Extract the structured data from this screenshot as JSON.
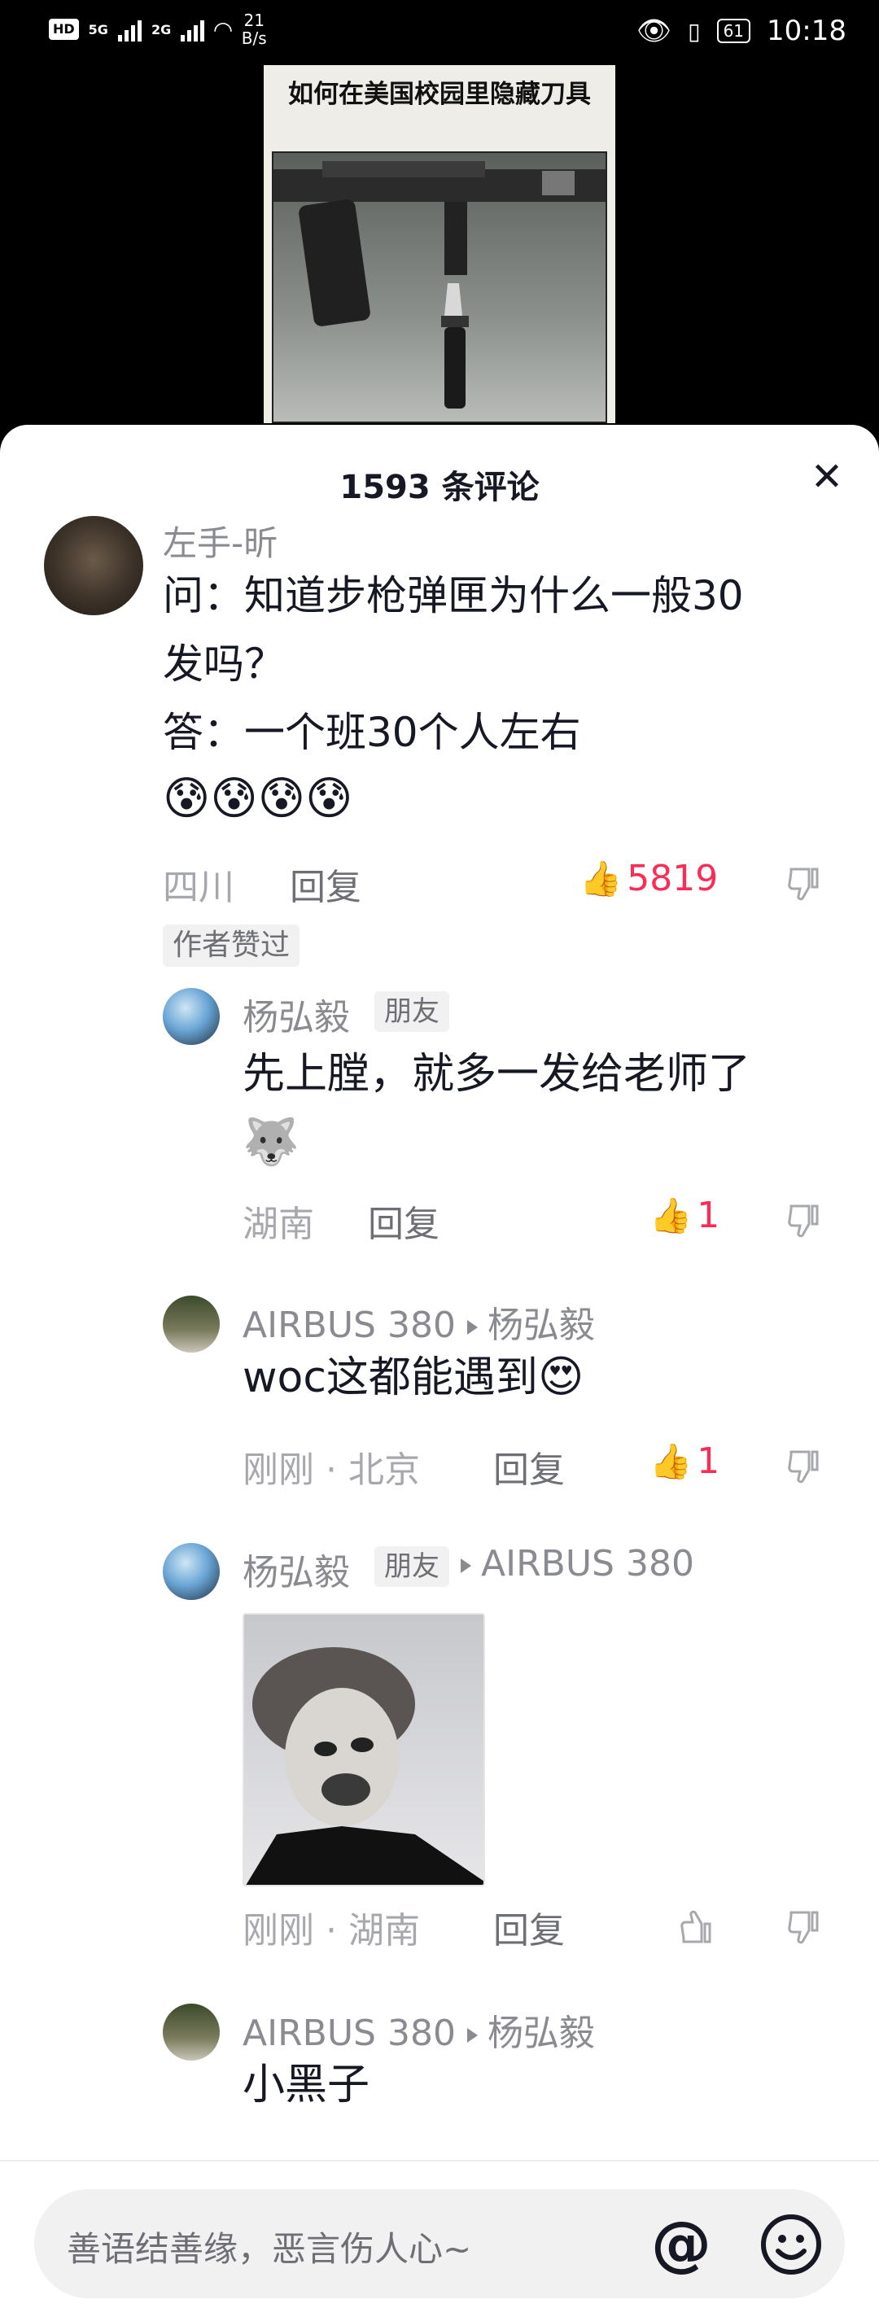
{
  "status_bar": {
    "network": "5G",
    "network2": "2G",
    "speed_value": "21",
    "speed_unit": "B/s",
    "battery": "61",
    "time": "10:18"
  },
  "video": {
    "overlay_title": "如何在美国校园里隐藏刀具"
  },
  "sheet": {
    "title": "1593 条评论",
    "close_icon": "close-icon"
  },
  "comments": [
    {
      "username": "左手-昕",
      "text_lines": [
        "问：知道步枪弹匣为什么一般30",
        "发吗？",
        "答：一个班30个人左右"
      ],
      "emojis": "😰😰😰😰",
      "location": "四川",
      "reply_label": "回复",
      "likes": "5819",
      "liked": true,
      "tag": "作者赞过"
    }
  ],
  "replies": [
    {
      "username": "杨弘毅",
      "badge": "朋友",
      "text": "先上膛，就多一发给老师了",
      "emoji": "🐺",
      "location": "湖南",
      "reply_label": "回复",
      "likes": "1",
      "liked": true
    },
    {
      "username": "AIRBUS 380",
      "reply_to": "杨弘毅",
      "text": "woc这都能遇到",
      "emoji": "😍",
      "time": "刚刚",
      "location": "北京",
      "reply_label": "回复",
      "likes": "1",
      "liked": true
    },
    {
      "username": "杨弘毅",
      "badge": "朋友",
      "reply_to": "AIRBUS 380",
      "time": "刚刚",
      "location": "湖南",
      "reply_label": "回复",
      "likes": "",
      "liked": false
    },
    {
      "username": "AIRBUS 380",
      "reply_to": "杨弘毅",
      "text": "小黑子"
    }
  ],
  "input": {
    "placeholder": "善语结善缘，恶言伤人心~",
    "at_label": "@"
  },
  "colors": {
    "accent_like": "#fe2c55",
    "text_primary": "#161823",
    "text_secondary": "#8a8b91"
  }
}
